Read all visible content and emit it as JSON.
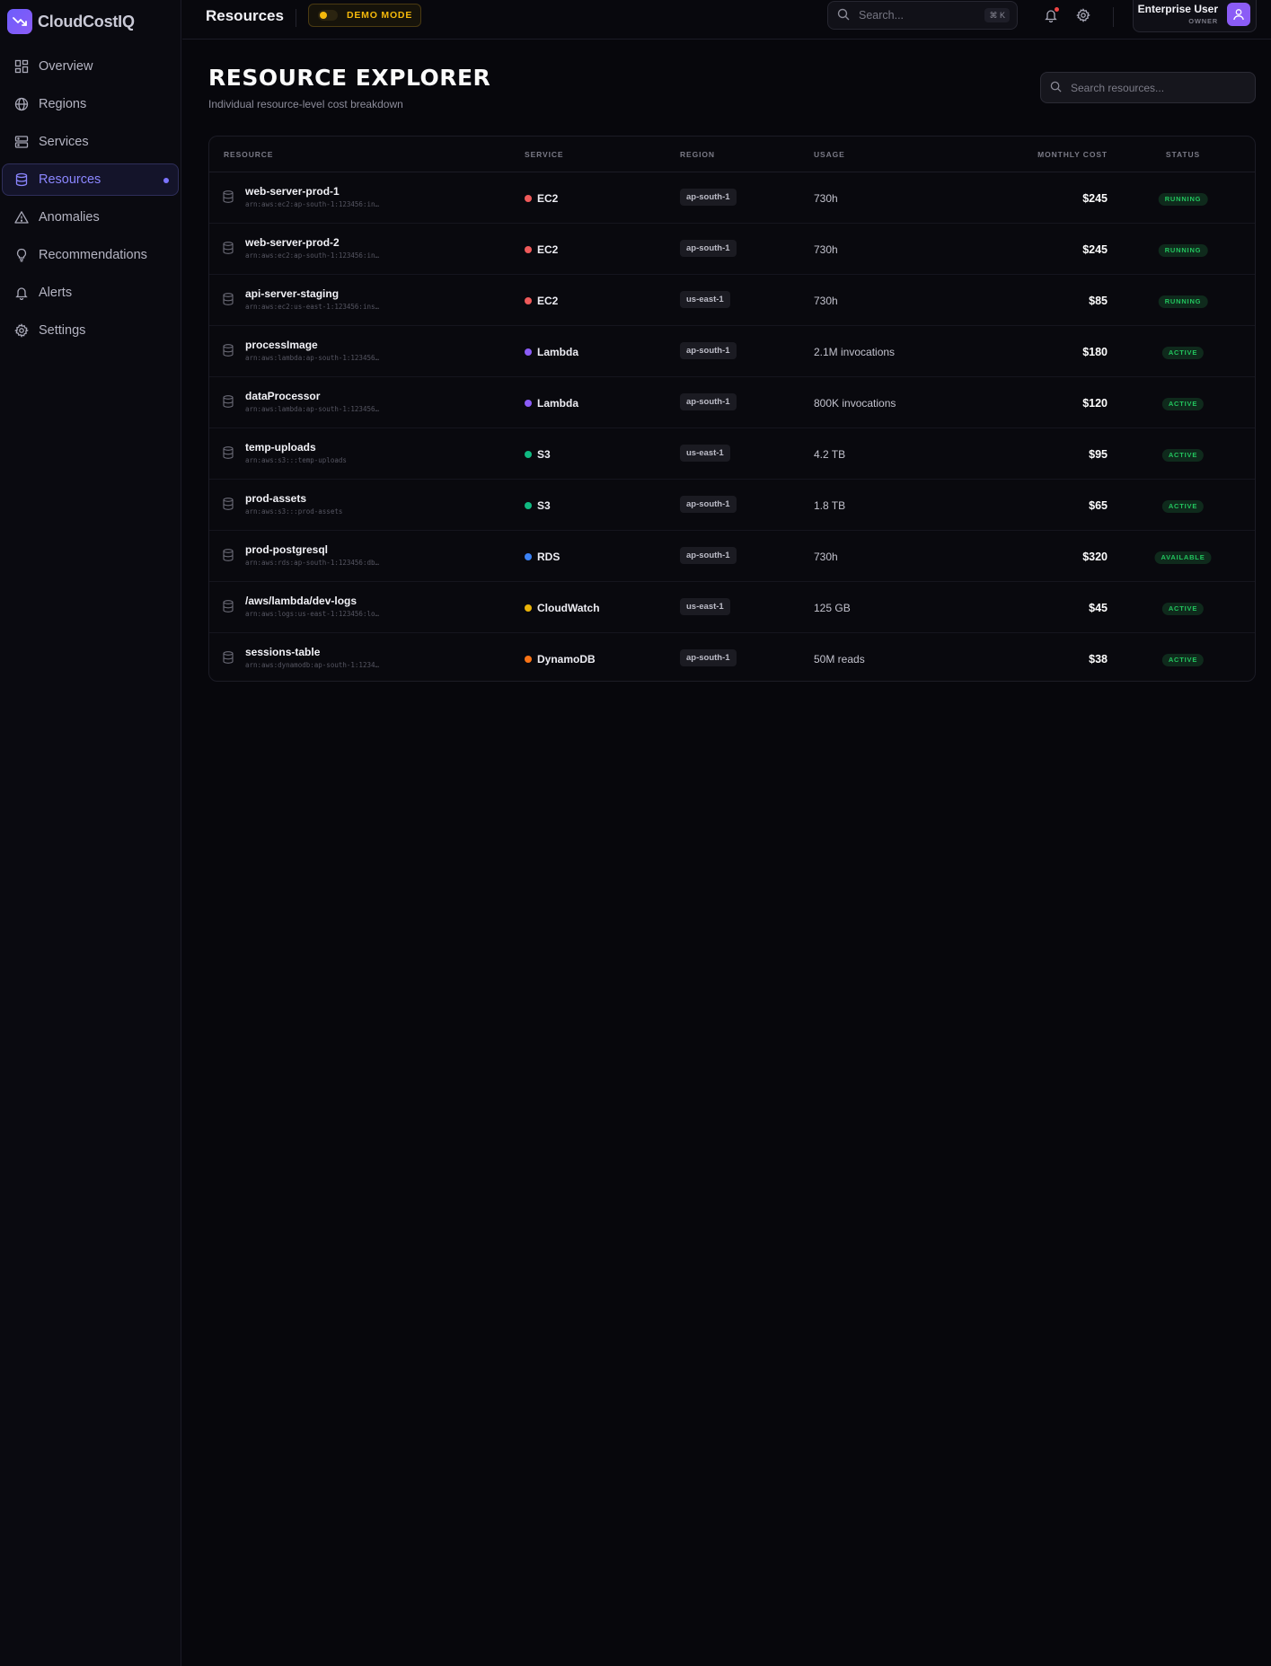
{
  "app": {
    "name": "CloudCostIQ"
  },
  "sidebar": {
    "items": [
      {
        "label": "Overview",
        "icon": "grid-icon",
        "active": false
      },
      {
        "label": "Regions",
        "icon": "globe-icon",
        "active": false
      },
      {
        "label": "Services",
        "icon": "server-icon",
        "active": false
      },
      {
        "label": "Resources",
        "icon": "database-icon",
        "active": true
      },
      {
        "label": "Anomalies",
        "icon": "warning-icon",
        "active": false
      },
      {
        "label": "Recommendations",
        "icon": "lightbulb-icon",
        "active": false
      },
      {
        "label": "Alerts",
        "icon": "bell-icon",
        "active": false
      },
      {
        "label": "Settings",
        "icon": "gear-icon",
        "active": false
      }
    ]
  },
  "topbar": {
    "title": "Resources",
    "demo_label": "DEMO MODE",
    "search_placeholder": "Search...",
    "shortcut": "⌘ K",
    "user_name": "Enterprise User",
    "user_role": "OWNER"
  },
  "main": {
    "heading": "RESOURCE EXPLORER",
    "subtitle": "Individual resource-level cost breakdown",
    "search_placeholder": "Search resources..."
  },
  "table": {
    "columns": {
      "resource": "RESOURCE",
      "service": "SERVICE",
      "region": "REGION",
      "usage": "USAGE",
      "cost": "MONTHLY COST",
      "status": "STATUS"
    },
    "rows": [
      {
        "name": "web-server-prod-1",
        "arn": "arn:aws:ec2:ap-south-1:123456:in…",
        "service": "EC2",
        "service_color": "#ef5a5a",
        "region": "ap-south-1",
        "usage": "730h",
        "cost": "$245",
        "status": "RUNNING"
      },
      {
        "name": "web-server-prod-2",
        "arn": "arn:aws:ec2:ap-south-1:123456:in…",
        "service": "EC2",
        "service_color": "#ef5a5a",
        "region": "ap-south-1",
        "usage": "730h",
        "cost": "$245",
        "status": "RUNNING"
      },
      {
        "name": "api-server-staging",
        "arn": "arn:aws:ec2:us-east-1:123456:ins…",
        "service": "EC2",
        "service_color": "#ef5a5a",
        "region": "us-east-1",
        "usage": "730h",
        "cost": "$85",
        "status": "RUNNING"
      },
      {
        "name": "processImage",
        "arn": "arn:aws:lambda:ap-south-1:123456…",
        "service": "Lambda",
        "service_color": "#8b5cf6",
        "region": "ap-south-1",
        "usage": "2.1M invocations",
        "cost": "$180",
        "status": "ACTIVE"
      },
      {
        "name": "dataProcessor",
        "arn": "arn:aws:lambda:ap-south-1:123456…",
        "service": "Lambda",
        "service_color": "#8b5cf6",
        "region": "ap-south-1",
        "usage": "800K invocations",
        "cost": "$120",
        "status": "ACTIVE"
      },
      {
        "name": "temp-uploads",
        "arn": "arn:aws:s3:::temp-uploads",
        "service": "S3",
        "service_color": "#10b981",
        "region": "us-east-1",
        "usage": "4.2 TB",
        "cost": "$95",
        "status": "ACTIVE"
      },
      {
        "name": "prod-assets",
        "arn": "arn:aws:s3:::prod-assets",
        "service": "S3",
        "service_color": "#10b981",
        "region": "ap-south-1",
        "usage": "1.8 TB",
        "cost": "$65",
        "status": "ACTIVE"
      },
      {
        "name": "prod-postgresql",
        "arn": "arn:aws:rds:ap-south-1:123456:db…",
        "service": "RDS",
        "service_color": "#3b82f6",
        "region": "ap-south-1",
        "usage": "730h",
        "cost": "$320",
        "status": "AVAILABLE"
      },
      {
        "name": "/aws/lambda/dev-logs",
        "arn": "arn:aws:logs:us-east-1:123456:lo…",
        "service": "CloudWatch",
        "service_color": "#eab308",
        "region": "us-east-1",
        "usage": "125 GB",
        "cost": "$45",
        "status": "ACTIVE"
      },
      {
        "name": "sessions-table",
        "arn": "arn:aws:dynamodb:ap-south-1:1234…",
        "service": "DynamoDB",
        "service_color": "#f97316",
        "region": "ap-south-1",
        "usage": "50M reads",
        "cost": "$38",
        "status": "ACTIVE"
      }
    ]
  },
  "colors": {
    "accent": "#7c74ff",
    "demo": "#f5b90b",
    "status_green": "#22c55e",
    "avatar": "#8b5cf6"
  }
}
